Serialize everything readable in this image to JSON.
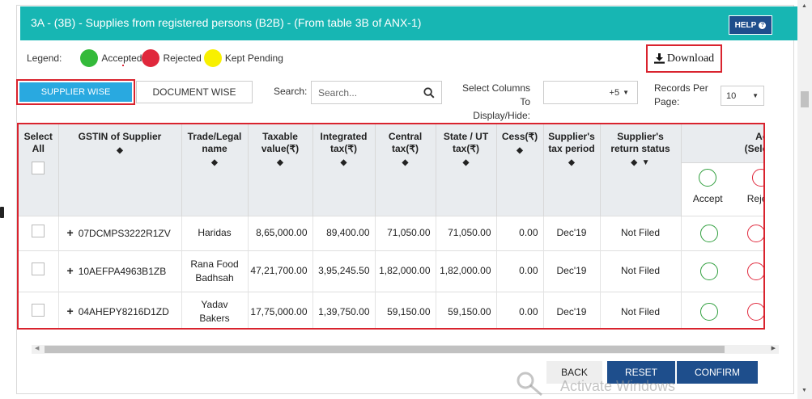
{
  "header": {
    "title": "3A - (3B) - Supplies from registered persons (B2B) - (From table 3B of ANX-1)",
    "help_label": "HELP"
  },
  "legend": {
    "label": "Legend:",
    "items": [
      {
        "label": "Accepted",
        "color": "#34ba3a"
      },
      {
        "label": "Rejected",
        "color": "#e0283c"
      },
      {
        "label": "Kept Pending",
        "color": "#f8f000"
      }
    ]
  },
  "download_label": "Download",
  "tabs": [
    {
      "label": "SUPPLIER WISE",
      "active": true
    },
    {
      "label": "DOCUMENT WISE",
      "active": false
    }
  ],
  "search": {
    "label": "Search:",
    "placeholder": "Search..."
  },
  "columns_select": {
    "label_line1": "Select Columns",
    "label_line2": "To Display/Hide:",
    "value": "+5"
  },
  "records_per_page": {
    "label_line1": "Records Per",
    "label_line2": "Page:",
    "value": "10"
  },
  "table": {
    "headers": {
      "select_all_1": "Select",
      "select_all_2": "All",
      "gstin": "GSTIN of Supplier",
      "trade_1": "Trade/Legal",
      "trade_2": "name",
      "taxable_1": "Taxable",
      "taxable_2": "value(₹)",
      "integrated_1": "Integrated",
      "integrated_2": "tax(₹)",
      "central_1": "Central",
      "central_2": "tax(₹)",
      "state_1": "State / UT",
      "state_2": "tax(₹)",
      "cess": "Cess(₹)",
      "period_1": "Supplier's",
      "period_2": "tax period",
      "status_1": "Supplier's",
      "status_2": "return status",
      "action_1": "Action",
      "action_2": "(Select A",
      "accept": "Accept",
      "reject": "Reject"
    },
    "rows": [
      {
        "gstin": "07DCMPS3222R1ZV",
        "name_1": "Haridas",
        "name_2": "",
        "taxable": "8,65,000.00",
        "integrated": "89,400.00",
        "central": "71,050.00",
        "state": "71,050.00",
        "cess": "0.00",
        "period": "Dec'19",
        "status": "Not Filed"
      },
      {
        "gstin": "10AEFPA4963B1ZB",
        "name_1": "Rana Food",
        "name_2": "Badhsah",
        "taxable": "47,21,700.00",
        "integrated": "3,95,245.50",
        "central": "1,82,000.00",
        "state": "1,82,000.00",
        "cess": "0.00",
        "period": "Dec'19",
        "status": "Not Filed"
      },
      {
        "gstin": "04AHEPY8216D1ZD",
        "name_1": "Yadav",
        "name_2": "Bakers",
        "taxable": "17,75,000.00",
        "integrated": "1,39,750.00",
        "central": "59,150.00",
        "state": "59,150.00",
        "cess": "0.00",
        "period": "Dec'19",
        "status": "Not Filed"
      }
    ]
  },
  "buttons": {
    "back": "BACK",
    "reset": "RESET",
    "confirm": "CONFIRM"
  },
  "watermark": "Activate Windows",
  "colors": {
    "header": "#17b6b3",
    "primary": "#1e4e8c",
    "active_tab": "#29a9e0",
    "highlight": "#d9232e"
  }
}
